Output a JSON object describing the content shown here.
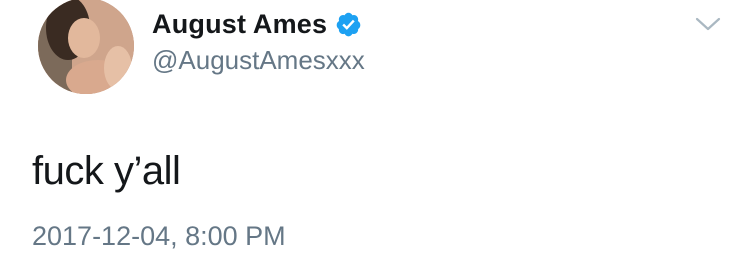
{
  "tweet": {
    "author": {
      "display_name": "August Ames",
      "handle": "@AugustAmesxxx",
      "verified": true,
      "avatar_icon": "profile-photo"
    },
    "text": "fuck y’all",
    "timestamp": "2017-12-04, 8:00 PM",
    "menu_icon": "chevron-down-icon"
  },
  "colors": {
    "name_text": "#14171a",
    "secondary_text": "#657786",
    "verified_badge": "#1da1f2",
    "background": "#ffffff"
  }
}
